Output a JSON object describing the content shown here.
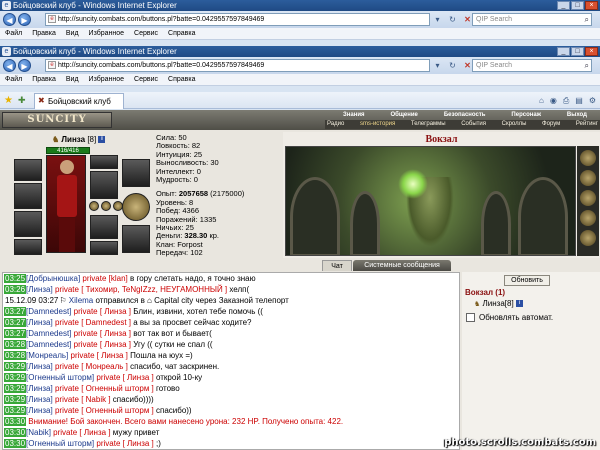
{
  "window": {
    "title": "Бойцовский клуб - Windows Internet Explorer"
  },
  "address": {
    "url": "http://suncity.combats.com/buttons.pl?batte=0.0429557597849469",
    "search_placeholder": "QIP Search"
  },
  "menu": [
    "Файл",
    "Правка",
    "Вид",
    "Избранное",
    "Сервис",
    "Справка"
  ],
  "tab": {
    "label": "Бойцовский клуб"
  },
  "game": {
    "logo": "SUNCITY",
    "topnav": [
      "Знания",
      "Общение",
      "Безопасность",
      "Персонаж",
      "Выход"
    ],
    "subnav": [
      "Радио",
      "sms-история",
      "Телеграммы",
      "События",
      "Скроллы",
      "Форум",
      "Рейтинг"
    ],
    "character": {
      "name": "Линза",
      "level": "[8]",
      "hp": "416/416",
      "stats": [
        "Сила: 50",
        "Ловкость: 82",
        "Интуиция: 25",
        "Выносливость: 30",
        "Интеллект: 0",
        "Мудрость: 0"
      ],
      "exp_label": "Опыт: ",
      "exp_value": "2057658",
      "exp_next": " (2175000)",
      "stats2": [
        "Уровень: 8",
        "Побед: 4366",
        "Поражений: 1335",
        "Ничьих: 25"
      ],
      "money_label": "Деньги: ",
      "money_value": "328.30",
      "money_unit": " кр.",
      "clan": "Клан: Forpost",
      "extra": "Передач: 102"
    },
    "location": {
      "title": "Вокзал",
      "list_title": "Вокзал (1)",
      "player_name": "Линза",
      "player_level": "[8]",
      "refresh_label": "Обновить",
      "auto_label": "Обновлять автомат."
    },
    "chat_tabs": {
      "chat": "Чат",
      "system": "Системные сообщения"
    },
    "chat": [
      {
        "time": "03:25",
        "pre": "",
        "nick": "[Добрынюшка]",
        "priv": " private [klan]",
        "to": "",
        "text": " в гору слетать надо, я точно знаю"
      },
      {
        "time": "03:26",
        "pre": "",
        "nick": "[Линза]",
        "priv": " private [ Тихомир, TeNgIZzz, НЕУГАМОННЫЙ ]",
        "to": "",
        "text": " хелп("
      },
      {
        "time": "15.12.09 03:27",
        "plain": true,
        "pre": "⚐ ",
        "nick": "Xilema",
        "priv": "",
        "to": "",
        "text": " отправился в ⌂ Capital city через Заказной телепорт"
      },
      {
        "time": "03:27",
        "pre": "",
        "nick": "[Damnedest]",
        "priv": " private [ Линза ]",
        "to": "",
        "text": " Блин, извини, хотел тебе помочь (("
      },
      {
        "time": "03:27",
        "pre": "",
        "nick": "[Линза]",
        "priv": " private [ Damnedest ]",
        "to": "",
        "text": " а вы за просвет сейчас ходите?"
      },
      {
        "time": "03:27",
        "pre": "",
        "nick": "[Damnedest]",
        "priv": " private [ Линза ]",
        "to": "",
        "text": " вот так вот и бывает("
      },
      {
        "time": "03:28",
        "pre": "",
        "nick": "[Damnedest]",
        "priv": " private [ Линза ]",
        "to": "",
        "text": " Угу (( сутки не спал (("
      },
      {
        "time": "03:28",
        "pre": "",
        "nick": "[Монреаль]",
        "priv": " private [ Линза ]",
        "to": "",
        "text": " Пошла на юух =)"
      },
      {
        "time": "03:29",
        "pre": "",
        "nick": "[Линза]",
        "priv": " private [ Монреаль ]",
        "to": "",
        "text": " спасибо, чат заскринен."
      },
      {
        "time": "03:29",
        "pre": "",
        "nick": "[Огненный шторм]",
        "priv": " private [ Линза ]",
        "to": "",
        "text": " открой 10-ку"
      },
      {
        "time": "03:29",
        "pre": "",
        "nick": "[Линза]",
        "priv": " private [ Огненный шторм ]",
        "to": "",
        "text": " готово"
      },
      {
        "time": "03:29",
        "pre": "",
        "nick": "[Линза]",
        "priv": " private [ Nabik ]",
        "to": "",
        "text": " спасибо))))"
      },
      {
        "time": "03:29",
        "pre": "",
        "nick": "[Линза]",
        "priv": " private [ Огненный шторм ]",
        "to": "",
        "text": " спасибо))"
      },
      {
        "time": "03:30",
        "system": true,
        "pre": "",
        "nick": "",
        "priv": "",
        "to": "",
        "text": " Внимание! Бой закончен. Всего вами нанесено урона: 232 HP. Получено опыта: 422."
      },
      {
        "time": "03:30",
        "pre": "",
        "nick": "[Nabik]",
        "priv": " private [ Линза ]",
        "to": "",
        "text": " мужу привет"
      },
      {
        "time": "03:30",
        "pre": "",
        "nick": "[Огненный шторм]",
        "priv": " private [ Линза ]",
        "to": "",
        "text": " ;)"
      },
      {
        "time": "03:31",
        "pre": "",
        "nick": "[Линза]",
        "priv": " private [ Nabik ]",
        "to": "",
        "text": " передам -))))"
      }
    ]
  },
  "watermark": "photo.scrolls.combats.com"
}
